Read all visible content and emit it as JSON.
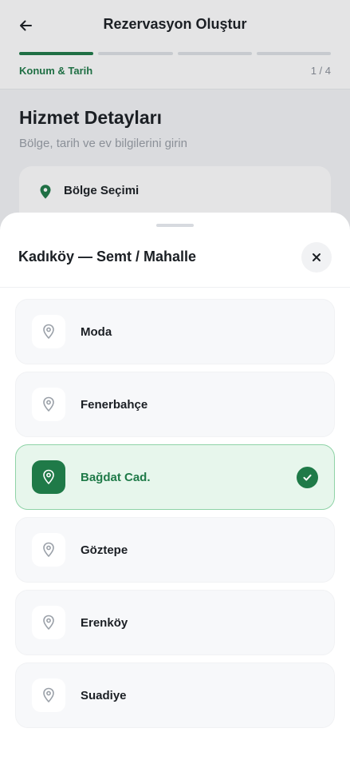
{
  "header": {
    "title": "Rezervasyon Oluştur",
    "step_label": "Konum & Tarih",
    "step_count": "1 / 4",
    "progress": {
      "current": 1,
      "total": 4
    }
  },
  "content": {
    "section_title": "Hizmet Detayları",
    "section_subtitle": "Bölge, tarih ve ev bilgilerini girin",
    "region_card_label": "Bölge Seçimi"
  },
  "sheet": {
    "title": "Kadıköy — Semt / Mahalle",
    "items": [
      {
        "label": "Moda",
        "selected": false
      },
      {
        "label": "Fenerbahçe",
        "selected": false
      },
      {
        "label": "Bağdat Cad.",
        "selected": true
      },
      {
        "label": "Göztepe",
        "selected": false
      },
      {
        "label": "Erenköy",
        "selected": false
      },
      {
        "label": "Suadiye",
        "selected": false
      }
    ]
  },
  "icons": {
    "back": "arrow-left-icon",
    "close": "close-icon",
    "pin": "map-pin-icon",
    "check": "check-icon"
  },
  "colors": {
    "accent": "#1f7a48",
    "selected_bg": "#e7f6ec",
    "selected_border": "#8fd3a7"
  }
}
